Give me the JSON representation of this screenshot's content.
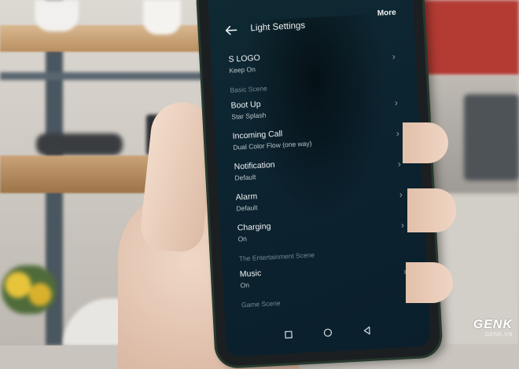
{
  "screen": {
    "title": "Light Settings",
    "more_label": "More",
    "items": [
      {
        "title": "S LOGO",
        "subtitle": "Keep On"
      },
      {
        "title": "Boot Up",
        "subtitle": "Star Splash"
      },
      {
        "title": "Incoming Call",
        "subtitle": "Dual Color Flow (one way)"
      },
      {
        "title": "Notification",
        "subtitle": "Default"
      },
      {
        "title": "Alarm",
        "subtitle": "Default"
      },
      {
        "title": "Charging",
        "subtitle": "On"
      },
      {
        "title": "Music",
        "subtitle": "On"
      }
    ],
    "sections": {
      "basic": "Basic Scene",
      "entertainment": "The Entertainment Scene",
      "game": "Game Scene"
    },
    "icons": {
      "back": "back-arrow-icon",
      "chevron": "chevron-right-icon",
      "nav_recent": "square-icon",
      "nav_home": "circle-icon",
      "nav_back": "triangle-icon"
    }
  },
  "watermark": {
    "logo": "GENK",
    "site": "GENK.VN"
  },
  "colors": {
    "screen_bg": "#0c2330",
    "text_primary": "#f2f5f6",
    "section_label": "#6f8891"
  }
}
